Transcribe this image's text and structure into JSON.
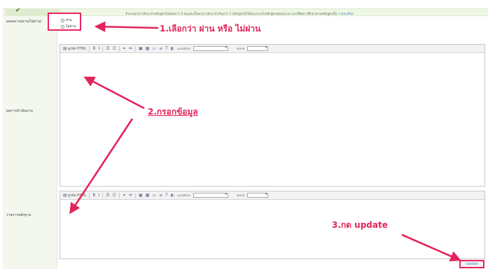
{
  "header": {
    "note": "จำนวนอาจารย์ประจำหลักสูตรไม่น้อยกว่า 5 คนและเป็นอาจารย์ประจำเกินกว่า 1 หลักสูตรไม่ได้และประจำหลักสูตรตลอดระยะเวลาที่จัดการศึกษาตามหลักสูตรนั้น",
    "note_link": "รายละเอียด"
  },
  "rows": {
    "result_label": "ผลผลงาน(ผ่าน/ไม่ผ่าน)",
    "result_options": [
      "ผ่าน",
      "ไม่ผ่าน"
    ],
    "performance_label": "ผลการดำเนินงาน",
    "evidence_label": "รายการหลักฐาน"
  },
  "editor": {
    "source_label": "ดูรหัส HTML",
    "font_label": "แบบอักษร",
    "size_label": "ขนาด"
  },
  "annotations": {
    "step1": "1.เลือกว่า ผ่าน หรือ ไม่ผ่าน",
    "step2": "2.กรอกข้อมูล",
    "step3": "3.กด update"
  },
  "update_button": "Update",
  "colors": {
    "annotation": "#e3245a",
    "check": "#3b7a1f",
    "header_bg": "#eef6e4"
  }
}
